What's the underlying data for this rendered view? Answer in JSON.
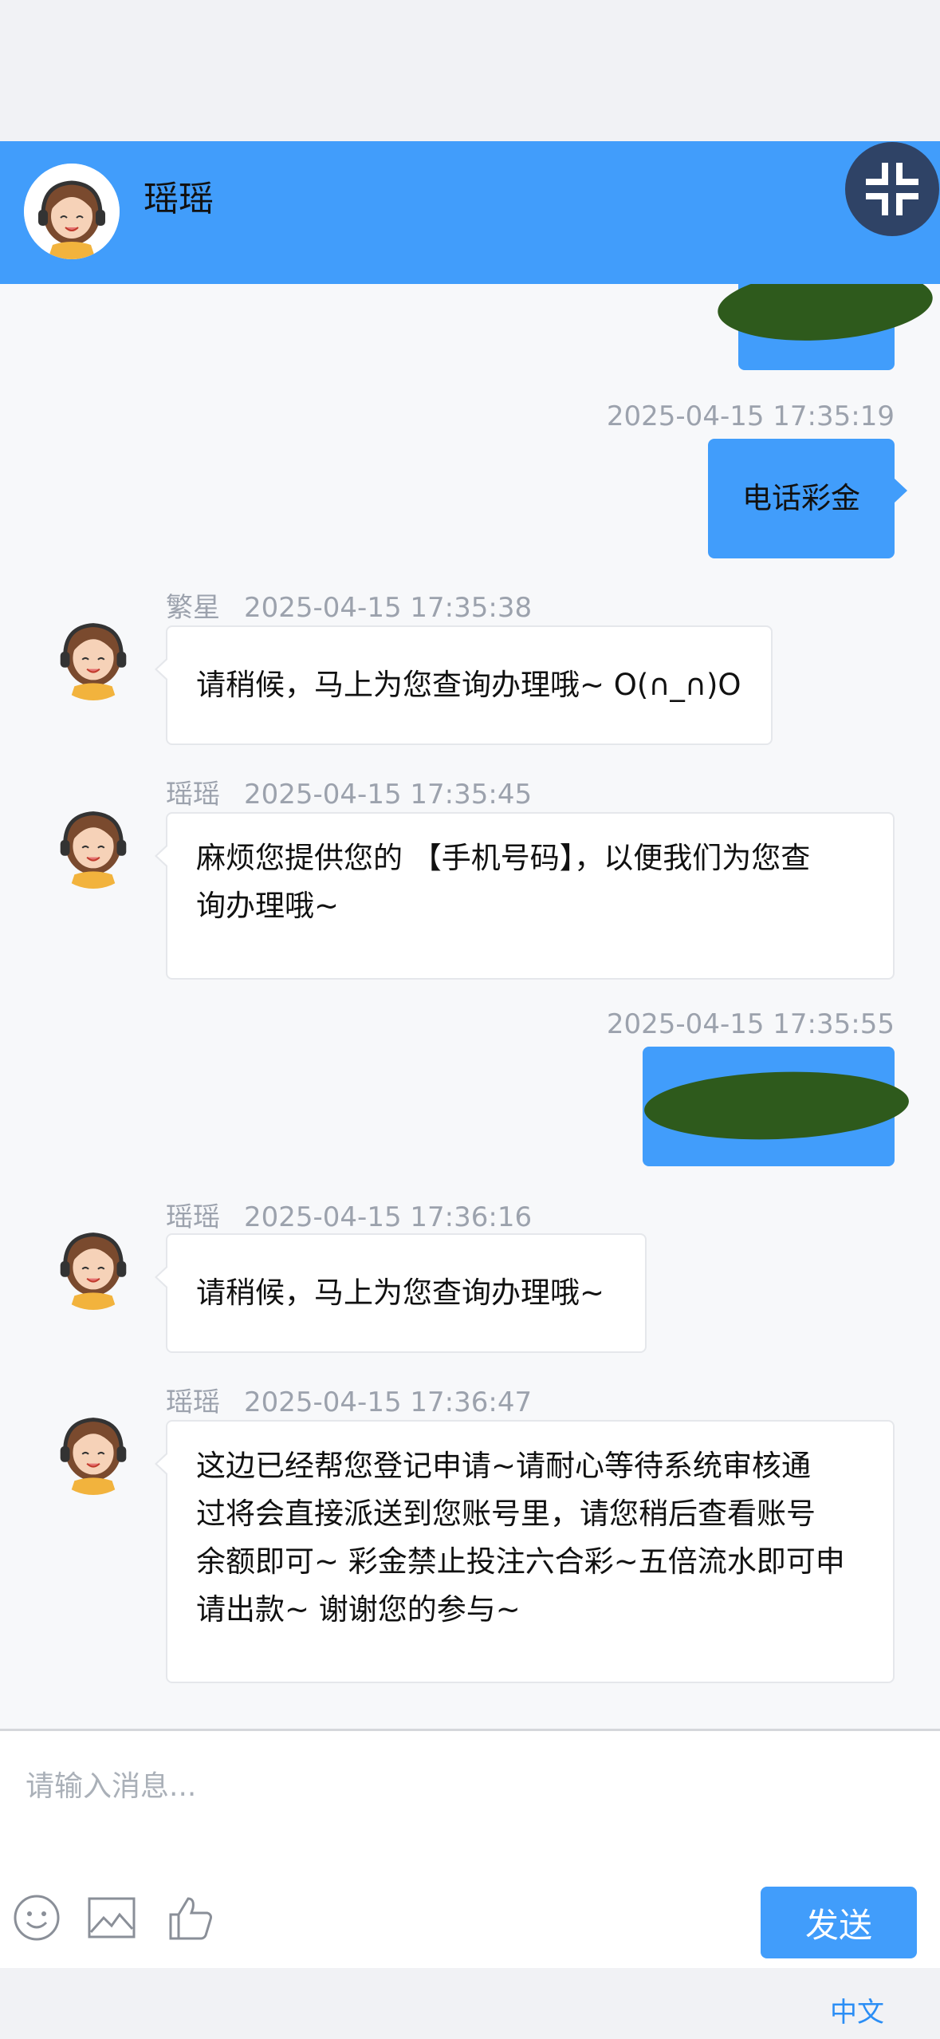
{
  "header": {
    "title": "瑶瑶"
  },
  "messages": [
    {
      "side": "right",
      "redacted": true
    },
    {
      "side": "right",
      "time": "2025-04-15 17:35:19",
      "text": "电话彩金"
    },
    {
      "side": "left",
      "name": "繁星",
      "time": "2025-04-15 17:35:38",
      "text": "请稍候，马上为您查询办理哦~ O(∩_∩)O"
    },
    {
      "side": "left",
      "name": "瑶瑶",
      "time": "2025-04-15 17:35:45",
      "lines": [
        "麻烦您提供您的 【手机号码】，以便我们为您查",
        "询办理哦~"
      ]
    },
    {
      "side": "right",
      "time": "2025-04-15 17:35:55",
      "redacted": true
    },
    {
      "side": "left",
      "name": "瑶瑶",
      "time": "2025-04-15 17:36:16",
      "text": "请稍候，马上为您查询办理哦~"
    },
    {
      "side": "left",
      "name": "瑶瑶",
      "time": "2025-04-15 17:36:47",
      "lines": [
        "这边已经帮您登记申请~请耐心等待系统审核通",
        "过将会直接派送到您账号里，请您稍后查看账号",
        "余额即可~ 彩金禁止投注六合彩~五倍流水即可申",
        "请出款~ 谢谢您的参与~"
      ]
    }
  ],
  "input": {
    "placeholder": "请输入消息..."
  },
  "toolbar": {
    "emoji_icon": "emoji-icon",
    "image_icon": "image-icon",
    "like_icon": "thumbs-up-icon"
  },
  "send_label": "发送",
  "language_label": "中文",
  "colors": {
    "accent": "#419dfb",
    "collapse_bg": "#2f4366",
    "redaction": "#2e5a1c"
  }
}
